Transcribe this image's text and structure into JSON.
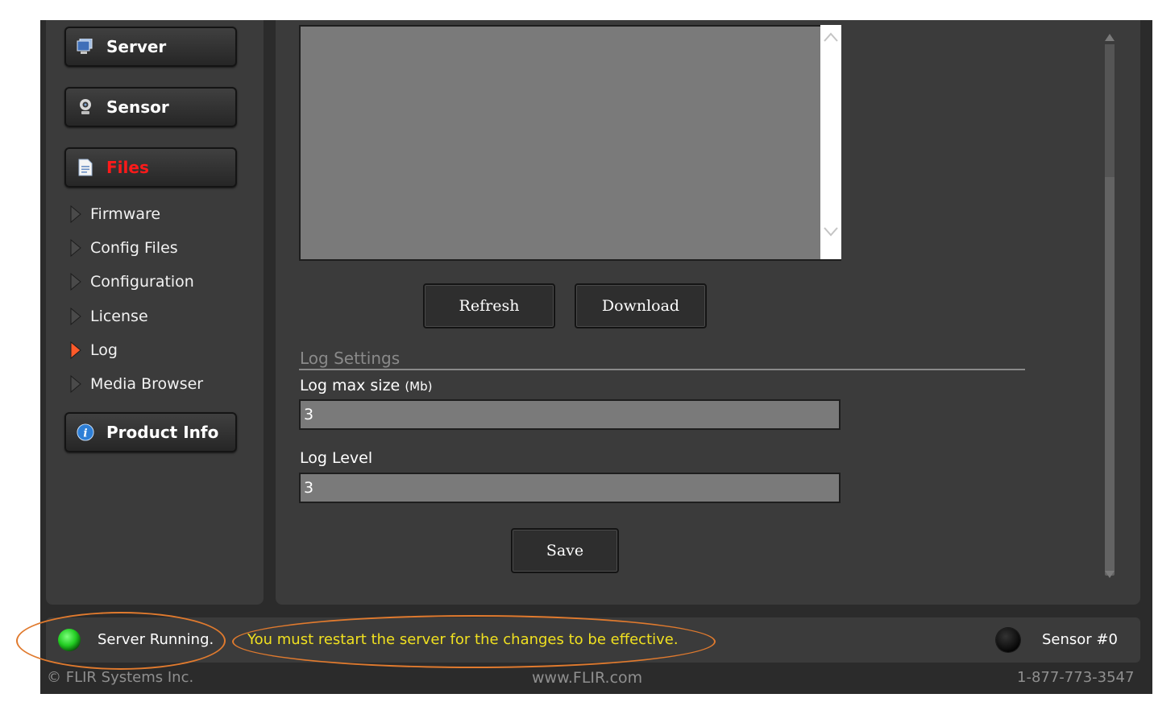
{
  "sidebar": {
    "buttons": [
      {
        "label": "Server",
        "icon": "monitor-icon"
      },
      {
        "label": "Sensor",
        "icon": "webcam-icon"
      },
      {
        "label": "Files",
        "icon": "document-icon",
        "active": true
      }
    ],
    "sub_items": [
      {
        "label": "Firmware"
      },
      {
        "label": "Config Files"
      },
      {
        "label": "Configuration"
      },
      {
        "label": "License"
      },
      {
        "label": "Log",
        "active": true
      },
      {
        "label": "Media Browser"
      }
    ],
    "product_info": {
      "label": "Product Info",
      "icon": "info-icon"
    }
  },
  "log_viewer": {
    "refresh_label": "Refresh",
    "download_label": "Download"
  },
  "log_settings": {
    "title": "Log Settings",
    "max_size_label": "Log max size",
    "max_size_unit": "(Mb)",
    "max_size_value": "3",
    "level_label": "Log Level",
    "level_value": "3",
    "save_label": "Save"
  },
  "status_bar": {
    "server_status": "Server Running.",
    "server_led_color": "#22cc22",
    "warning": "You must restart the server for the changes to be effective.",
    "warning_color": "#f0e020",
    "sensor_label": "Sensor #0",
    "sensor_led_color": "#111111"
  },
  "footer": {
    "copyright": "© FLIR Systems Inc.",
    "website": "www.FLIR.com",
    "phone": "1-877-773-3547"
  },
  "colors": {
    "active_nav": "#ff1a1a",
    "annotation": "#e07a2e"
  }
}
